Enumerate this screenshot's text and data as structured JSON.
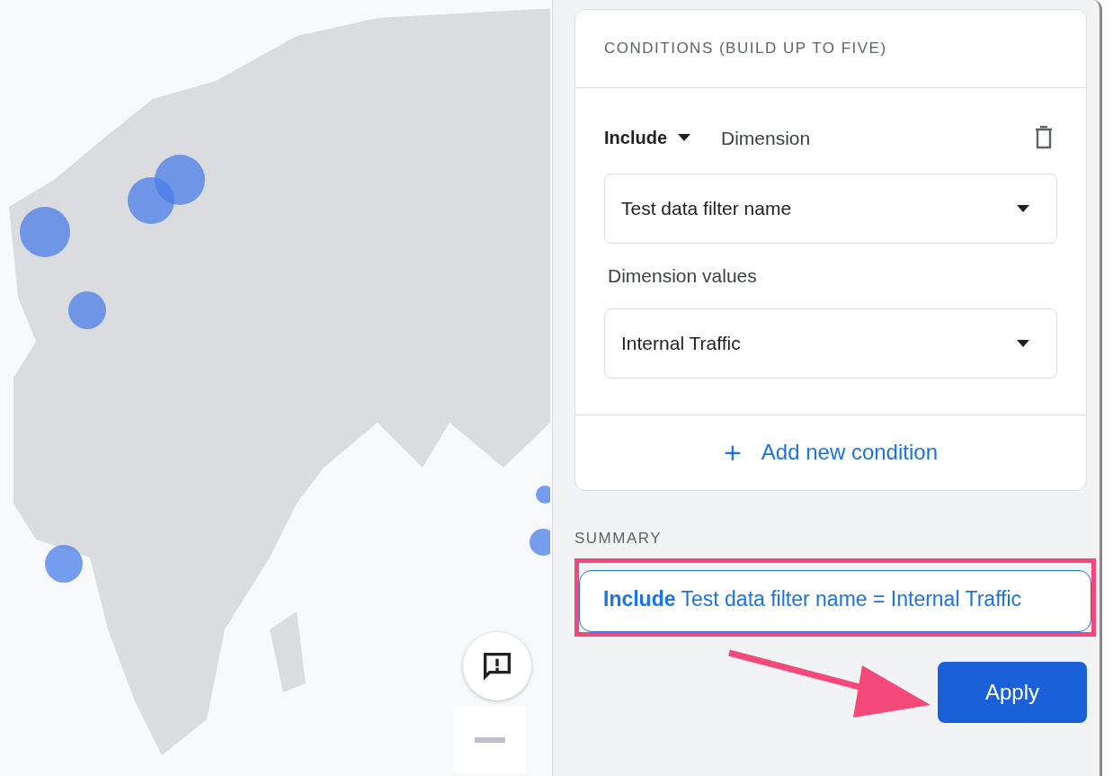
{
  "conditions": {
    "heading": "CONDITIONS (BUILD UP TO FIVE)",
    "mode": {
      "label": "Include"
    },
    "type_label": "Dimension",
    "dimension_select": {
      "value": "Test data filter name"
    },
    "values_label": "Dimension values",
    "values_select": {
      "value": "Internal Traffic"
    },
    "add_button": {
      "icon": "+",
      "label": "Add new condition"
    }
  },
  "summary": {
    "heading": "SUMMARY",
    "text": "**Include** Test data filter name = Internal Traffic",
    "highlighted": true
  },
  "apply_button": {
    "label": "Apply",
    "pointed_at": true
  }
}
